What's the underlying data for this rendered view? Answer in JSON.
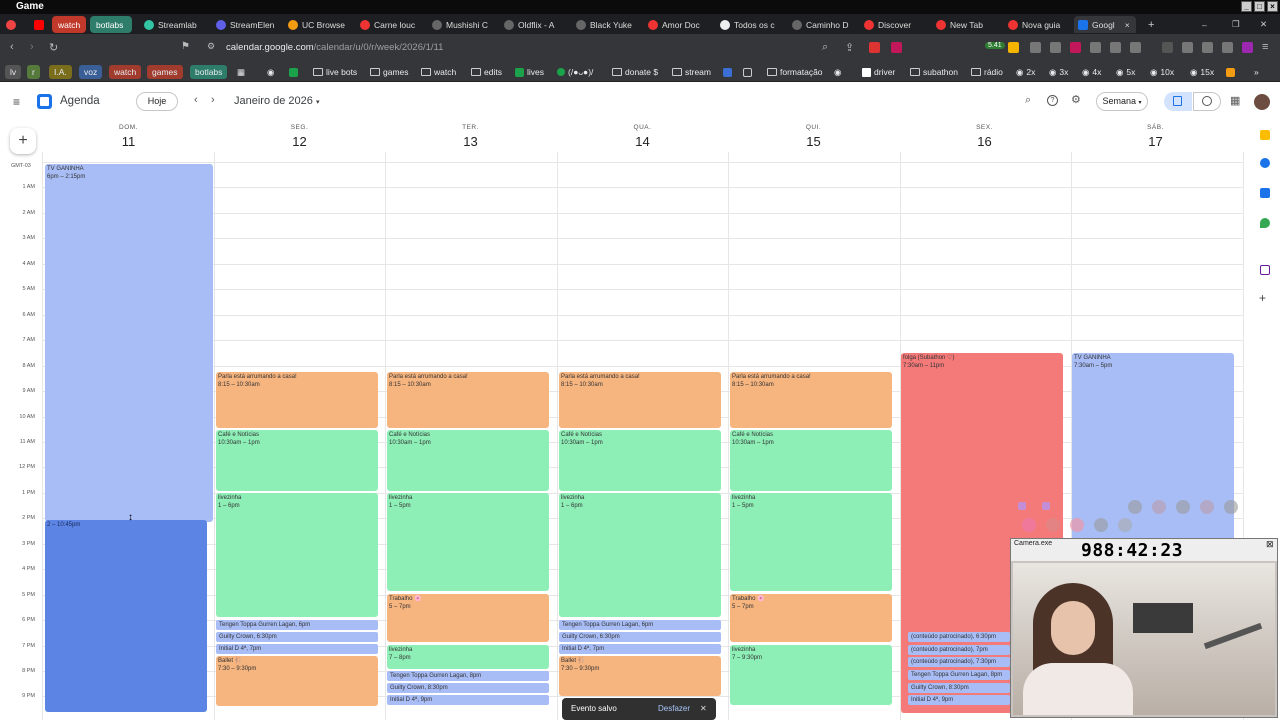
{
  "os": {
    "title": "Game"
  },
  "tabs": [
    {
      "label": "watch",
      "color": "#c0392b",
      "pill": true
    },
    {
      "label": "botlabs",
      "color": "#2e7d6b",
      "pill": true
    },
    {
      "label": "Streamlab"
    },
    {
      "label": "StreamElen"
    },
    {
      "label": "UC Browse"
    },
    {
      "label": "Carne louc"
    },
    {
      "label": "Mushishi C"
    },
    {
      "label": "Oldflix - A"
    },
    {
      "label": "Black Yuke"
    },
    {
      "label": "Amor Doc"
    },
    {
      "label": "Todos os c"
    },
    {
      "label": "Caminho D"
    },
    {
      "label": "Discover"
    },
    {
      "label": "New Tab"
    },
    {
      "label": "Nova guia"
    },
    {
      "label": "Googl",
      "active": true
    }
  ],
  "url": {
    "host": "calendar.google.com",
    "path": "/calendar/u/0/r/week/2026/1/11"
  },
  "ext_badge": "5.41",
  "bookmarks": [
    {
      "label": "lv"
    },
    {
      "label": "r"
    },
    {
      "label": "I.A."
    },
    {
      "label": "voz"
    },
    {
      "label": "watch"
    },
    {
      "label": "games"
    },
    {
      "label": "botlabs"
    },
    {
      "label": "live bots"
    },
    {
      "label": "games"
    },
    {
      "label": "watch"
    },
    {
      "label": "edits"
    },
    {
      "label": "lives"
    },
    {
      "label": "(/●ᴗ●)/"
    },
    {
      "label": "donate $"
    },
    {
      "label": "stream"
    },
    {
      "label": "formatação"
    },
    {
      "label": "driver"
    },
    {
      "label": "subathon"
    },
    {
      "label": "rádio"
    },
    {
      "label": "2x"
    },
    {
      "label": "3x"
    },
    {
      "label": "4x"
    },
    {
      "label": "5x"
    },
    {
      "label": "10x"
    },
    {
      "label": "15x"
    }
  ],
  "app": {
    "name": "Agenda",
    "today_label": "Hoje",
    "month_label": "Janeiro de 2026",
    "view_label": "Semana",
    "timezone": "GMT-03"
  },
  "days": [
    {
      "name": "DOM.",
      "num": "11"
    },
    {
      "name": "SEG.",
      "num": "12"
    },
    {
      "name": "TER.",
      "num": "13"
    },
    {
      "name": "QUA.",
      "num": "14"
    },
    {
      "name": "QUI.",
      "num": "15"
    },
    {
      "name": "SEX.",
      "num": "16"
    },
    {
      "name": "SÁB.",
      "num": "17"
    }
  ],
  "hours": [
    "1 AM",
    "2 AM",
    "3 AM",
    "4 AM",
    "5 AM",
    "6 AM",
    "7 AM",
    "8 AM",
    "9 AM",
    "10 AM",
    "11 AM",
    "12 PM",
    "1 PM",
    "2 PM",
    "3 PM",
    "4 PM",
    "5 PM",
    "6 PM",
    "7 PM",
    "8 PM",
    "9 PM"
  ],
  "events": {
    "sun_tv": {
      "title": "TV GANINHA",
      "time": "6pm – 2:15pm"
    },
    "sun_dark": {
      "title": "",
      "time": "2 – 10:45pm"
    },
    "parla": {
      "title": "Parla está arrumando a casa!",
      "time": "8:15 – 10:30am"
    },
    "cafe": {
      "title": "Café e Notícias",
      "time": "10:30am – 1pm"
    },
    "live_mon": {
      "title": "livezinha",
      "time": "1 – 6pm"
    },
    "live_tue": {
      "title": "livezinha",
      "time": "1 – 5pm"
    },
    "trabalho": {
      "title": "Trabalho 🌸",
      "time": "5 – 7pm"
    },
    "tengen": {
      "title": "Tengen Toppa Gurren Lagan, 6pm"
    },
    "guilty": {
      "title": "Guilty Crown, 6:30pm"
    },
    "initiald": {
      "title": "Initial D 4ª, 7pm"
    },
    "ballet": {
      "title": "Ballet 🩰",
      "time": "7:30 – 9:30pm"
    },
    "live_tue_eve": {
      "title": "livezinha",
      "time": "7 – 8pm"
    },
    "tengen_8": {
      "title": "Tengen Toppa Gurren Lagan, 8pm"
    },
    "guilty_830": {
      "title": "Guilty Crown, 8:30pm"
    },
    "initiald_9": {
      "title": "Initial D 4ª, 9pm"
    },
    "live_thu_eve": {
      "title": "livezinha",
      "time": "7 – 9:30pm"
    },
    "folga": {
      "title": "folga (Subathon ♡)",
      "time": "7:30am – 11pm"
    },
    "patro1": {
      "title": "(conteúdo patrocinado), 6:30pm"
    },
    "patro2": {
      "title": "(conteúdo patrocinado), 7pm"
    },
    "patro3": {
      "title": "(conteúdo patrocinado), 7:30pm"
    },
    "tengen_fri": {
      "title": "Tengen Toppa Gurren Lagan, 8pm"
    },
    "guilty_fri": {
      "title": "Guilty Crown, 8:30pm"
    },
    "initiald_fri": {
      "title": "Initial D 4ª, 9pm"
    },
    "sat_tv": {
      "title": "TV GANINHA",
      "time": "7:30am – 5pm"
    }
  },
  "toast": {
    "message": "Evento salvo",
    "undo": "Desfazer"
  },
  "camera": {
    "title": "Camera.exe",
    "timer": "988:42:23"
  },
  "colors": {
    "orange": "#f6b47f",
    "green": "#8deeb6",
    "lavender": "#a8bdf6",
    "blue": "#5b84e5",
    "red": "#f47a7a"
  }
}
